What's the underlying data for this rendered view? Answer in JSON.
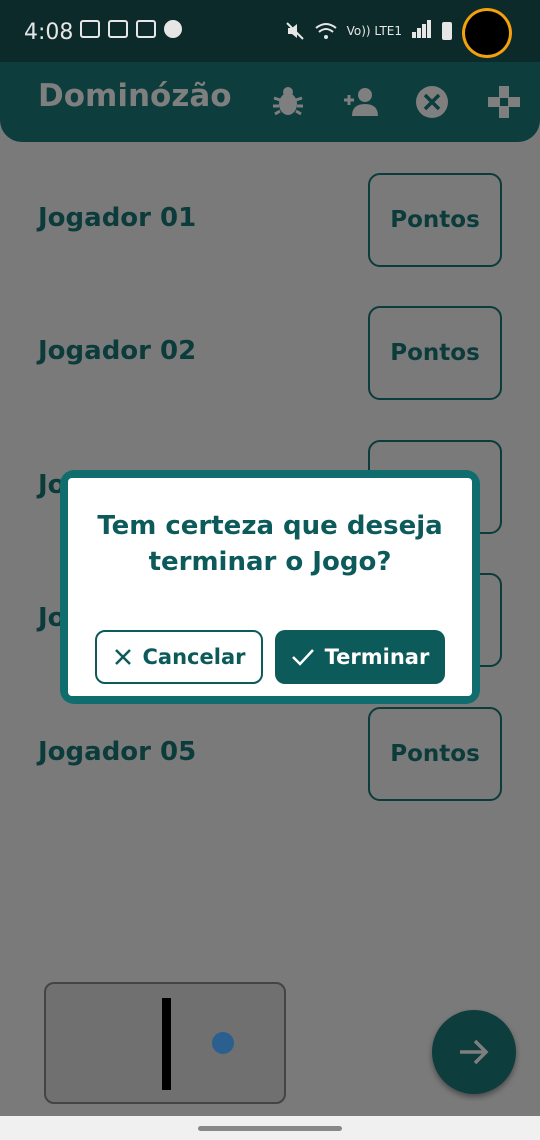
{
  "status_bar": {
    "time": "4:08",
    "network_label": "Vo)) LTE1"
  },
  "app_bar": {
    "title": "Dominózão",
    "icons": [
      "bug-icon",
      "add-person-icon",
      "close-circle-icon",
      "gamepad-icon"
    ]
  },
  "players": [
    {
      "name": "Jogador 01",
      "button": "Pontos"
    },
    {
      "name": "Jogador 02",
      "button": "Pontos"
    },
    {
      "name": "Jo",
      "button": ""
    },
    {
      "name": "Jo",
      "button": ""
    },
    {
      "name": "Jogador 05",
      "button": "Pontos"
    }
  ],
  "dialog": {
    "message_line1": "Tem certeza que deseja",
    "message_line2": "terminar o Jogo?",
    "cancel_label": "Cancelar",
    "confirm_label": "Terminar"
  },
  "colors": {
    "primary": "#0d3d3d",
    "accent": "#0c5a5a",
    "scrim": "#7a7a7a"
  }
}
